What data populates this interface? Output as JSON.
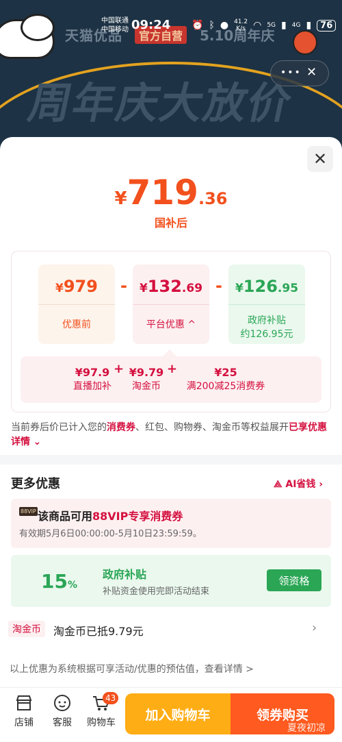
{
  "status_bar": {
    "carrier1": "中国联通",
    "carrier2": "中国移动",
    "time": "09:24",
    "speed_value": "41.2",
    "speed_unit": "K/s",
    "net1": "5G",
    "net2": "4G",
    "battery": "76"
  },
  "banner": {
    "brand": "天猫优品",
    "badge": "官方自营",
    "anniversary": "5.10周年庆",
    "headline": "周年庆大放价"
  },
  "price": {
    "currency": "¥",
    "integer": "719",
    "decimal": ".36",
    "label": "国补后"
  },
  "calc": {
    "box1": {
      "yen": "¥",
      "value": "979",
      "decimal": "",
      "label": "优惠前"
    },
    "box2": {
      "yen": "¥",
      "value": "132",
      "decimal": ".69",
      "label": "平台优惠",
      "chevron": "^"
    },
    "box3": {
      "yen": "¥",
      "value": "126",
      "decimal": ".95",
      "label": "政府补贴",
      "label2": "约126.95元"
    },
    "minus": "-",
    "plus": "+",
    "sub_items": [
      {
        "value": "¥97.9",
        "label": "直播加补"
      },
      {
        "value": "¥9.79",
        "label": "淘金币"
      },
      {
        "value": "¥25",
        "label": "满200减25消费券"
      }
    ]
  },
  "notice": {
    "part1": "当前券后价已计入您的",
    "em1": "消费券",
    "part2": "、红包、购物券、淘金币等权益展开",
    "em2": "已享优惠详情",
    "chevron": "⌄"
  },
  "more": {
    "title": "更多优惠",
    "ai_link": "AI省钱 ›",
    "vip": {
      "badge": "88VIP",
      "title_prefix": "该商品可用",
      "title_em": "88VIP专享消费券",
      "date": "有效期5月6日00:00:00-5月10日23:59:59。"
    },
    "gov": {
      "percent": "15",
      "percent_sign": "%",
      "title": "政府补贴",
      "desc": "补贴资金使用完即活动结束",
      "button": "领资格"
    },
    "coin": {
      "tag": "淘金币",
      "text": "淘金币已抵9.79元",
      "arrow": "›"
    },
    "disclaimer": "以上优惠为系统根据可享活动/优惠的预估值，查看详情 >"
  },
  "bottom": {
    "store": "店铺",
    "service": "客服",
    "cart": "购物车",
    "cart_count": "43",
    "add_cart": "加入购物车",
    "buy": "领券购买",
    "watermark": "夏夜初凉"
  },
  "colors": {
    "accent": "#f2501d",
    "red": "#d4103f",
    "green": "#2aa655",
    "orange_btn": "#ffad15"
  }
}
